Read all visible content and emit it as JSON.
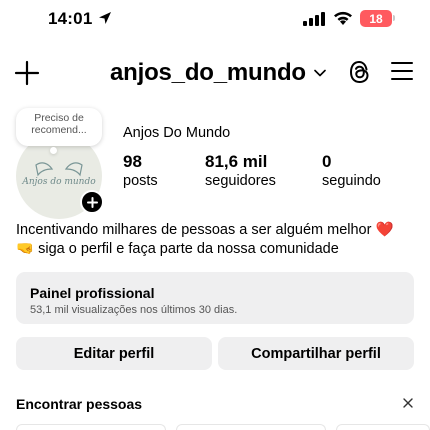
{
  "status": {
    "time": "14:01",
    "battery": "18",
    "icons": [
      "location-arrow-icon",
      "cellular-signal-icon",
      "wifi-icon",
      "battery-icon"
    ],
    "battery_color": "#ff5a5f"
  },
  "header": {
    "username": "anjos_do_mundo",
    "icons": [
      "plus-icon",
      "chevron-down-icon",
      "threads-icon",
      "menu-icon"
    ]
  },
  "profile": {
    "note": "Preciso de recomend...",
    "avatar_text": "Anjos do mundo",
    "display_name": "Anjos Do Mundo",
    "stats": [
      {
        "value": "98",
        "label": "posts"
      },
      {
        "value": "81,6 mil",
        "label": "seguidores"
      },
      {
        "value": "0",
        "label": "seguindo"
      }
    ],
    "bio_line1": "Incentivando milhares de pessoas a ser alguém melhor",
    "bio_emoji1": "❤️",
    "bio_emoji2": "🤜",
    "bio_line2": "siga o perfil e faça parte da nossa comunidade"
  },
  "professional_panel": {
    "title": "Painel profissional",
    "subtitle": "53,1 mil visualizações nos últimos 30 dias."
  },
  "buttons": {
    "edit": "Editar perfil",
    "share": "Compartilhar perfil"
  },
  "find_people": {
    "title": "Encontrar pessoas",
    "close": "×"
  }
}
